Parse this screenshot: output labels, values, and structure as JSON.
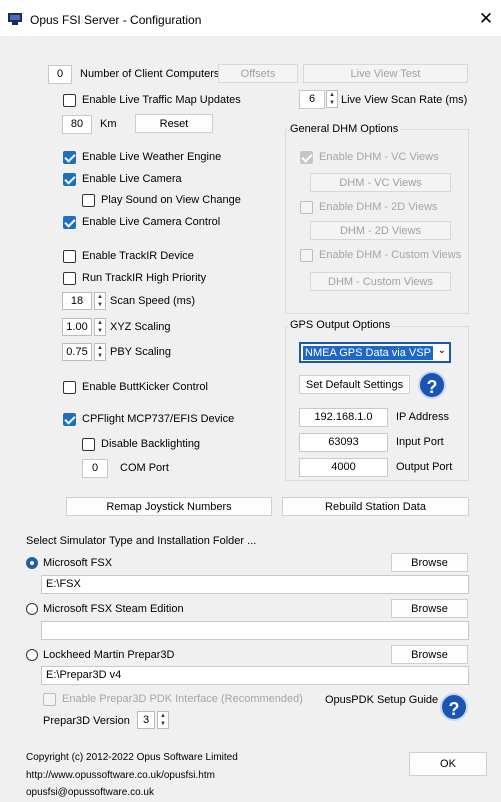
{
  "window": {
    "title": "Opus FSI Server - Configuration",
    "close_glyph": "✕"
  },
  "top": {
    "client_count": "0",
    "client_count_label": "Number of Client Computers",
    "offsets_label": "Offsets",
    "live_view_test_label": "Live View Test",
    "live_traffic_label": "Enable Live Traffic Map Updates",
    "km_value": "80",
    "km_label": "Km",
    "reset_label": "Reset",
    "scan_rate_value": "6",
    "scan_rate_label": "Live View Scan Rate (ms)"
  },
  "left": {
    "weather_engine": {
      "label": "Enable Live Weather Engine",
      "checked": true
    },
    "live_camera": {
      "label": "Enable Live Camera",
      "checked": true
    },
    "play_sound": {
      "label": "Play Sound on View Change",
      "checked": false
    },
    "camera_control": {
      "label": "Enable Live Camera Control",
      "checked": true
    },
    "trackir": {
      "label": "Enable TrackIR Device",
      "checked": false
    },
    "trackir_priority": {
      "label": "Run TrackIR High Priority",
      "checked": false
    },
    "scan_speed": {
      "value": "18",
      "label": "Scan Speed (ms)"
    },
    "xyz": {
      "value": "1.00",
      "label": "XYZ Scaling"
    },
    "pby": {
      "value": "0.75",
      "label": "PBY Scaling"
    },
    "buttkicker": {
      "label": "Enable ButtKicker Control",
      "checked": false
    },
    "cpflight": {
      "label": "CPFlight MCP737/EFIS Device",
      "checked": true
    },
    "backlighting": {
      "label": "Disable Backlighting",
      "checked": false
    },
    "com_port": {
      "value": "0",
      "label": "COM Port"
    },
    "remap_label": "Remap Joystick Numbers"
  },
  "dhm": {
    "title": "General DHM Options",
    "vc_enable": "Enable DHM - VC Views",
    "vc_button": "DHM - VC Views",
    "views2d_enable": "Enable DHM - 2D Views",
    "views2d_button": "DHM - 2D Views",
    "custom_enable": "Enable DHM - Custom Views",
    "custom_button": "DHM - Custom Views"
  },
  "gps": {
    "title": "GPS Output Options",
    "selected": "NMEA GPS Data via VSP",
    "set_default_label": "Set Default Settings",
    "help_glyph": "?",
    "ip": {
      "value": "192.168.1.0",
      "label": "IP Address"
    },
    "input_port": {
      "value": "63093",
      "label": "Input Port"
    },
    "output_port": {
      "value": "4000",
      "label": "Output Port"
    },
    "rebuild_label": "Rebuild Station Data"
  },
  "sim": {
    "heading": "Select Simulator Type and Installation Folder ...",
    "options": [
      {
        "label": "Microsoft FSX",
        "path": "E:\\FSX",
        "selected": true,
        "browse": "Browse"
      },
      {
        "label": "Microsoft FSX Steam Edition",
        "path": "",
        "selected": false,
        "browse": "Browse"
      },
      {
        "label": "Lockheed Martin Prepar3D",
        "path": "E:\\Prepar3D v4",
        "selected": false,
        "browse": "Browse"
      }
    ],
    "pdk_label": "Enable Prepar3D PDK Interface (Recommended)",
    "setup_guide_label": "OpusPDK Setup Guide",
    "version_label": "Prepar3D Version",
    "version_value": "3"
  },
  "footer": {
    "copyright": "Copyright (c) 2012-2022 Opus Software Limited",
    "url": "http://www.opussoftware.co.uk/opusfsi.htm",
    "email": "opusfsi@opussoftware.co.uk",
    "ok_label": "OK"
  },
  "colors": {
    "accent": "#1f6fc0",
    "background": "#f0f0f0",
    "help_blue": "#1a55b4"
  }
}
